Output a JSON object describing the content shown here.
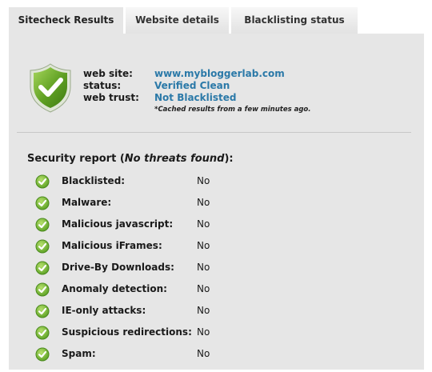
{
  "tabs": [
    "Sitecheck Results",
    "Website details",
    "Blacklisting status"
  ],
  "summary": {
    "website_label": "web site:",
    "website_value": "www.mybloggerlab.com",
    "status_label": "status:",
    "status_value": "Verified Clean",
    "trust_label": "web trust:",
    "trust_value": "Not Blacklisted",
    "cache_note": "*Cached results from a few minutes ago."
  },
  "report": {
    "title_prefix": "Security report (",
    "title_emphasis": "No threats found",
    "title_suffix": "):",
    "items": [
      {
        "name": "Blacklisted:",
        "result": "No"
      },
      {
        "name": "Malware:",
        "result": "No"
      },
      {
        "name": "Malicious javascript:",
        "result": "No"
      },
      {
        "name": "Malicious iFrames:",
        "result": "No"
      },
      {
        "name": "Drive-By Downloads:",
        "result": "No"
      },
      {
        "name": "Anomaly detection:",
        "result": "No"
      },
      {
        "name": "IE-only attacks:",
        "result": "No"
      },
      {
        "name": "Suspicious redirections:",
        "result": "No"
      },
      {
        "name": "Spam:",
        "result": "No"
      }
    ]
  },
  "colors": {
    "accent_link": "#2b79a8",
    "check_green": "#5aa023",
    "shield_green": "#6fae2b"
  },
  "icons": {
    "shield": "shield-check-icon",
    "item_check": "check-circle-icon"
  }
}
